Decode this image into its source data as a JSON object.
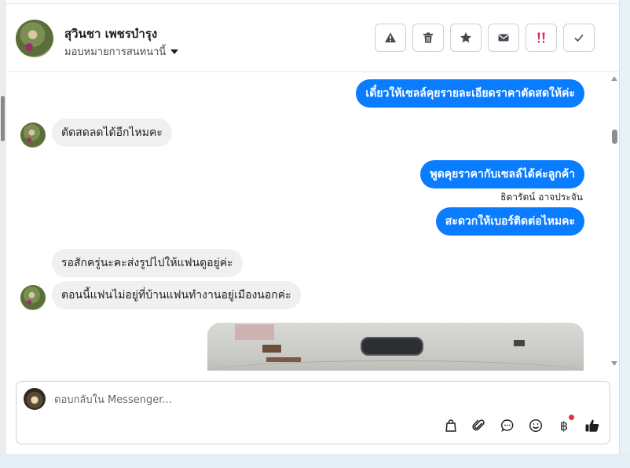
{
  "header": {
    "contact_name": "สุวินชา เพชรบำรุง",
    "assign_label": "มอบหมายการสนทนานี้",
    "actions": [
      {
        "name": "warning-icon",
        "color": "#444950"
      },
      {
        "name": "trash-icon",
        "color": "#444950"
      },
      {
        "name": "star-icon",
        "color": "#444950"
      },
      {
        "name": "mail-icon",
        "color": "#444950"
      },
      {
        "name": "double-exclamation-icon",
        "color": "#e0245e"
      },
      {
        "name": "check-icon",
        "color": "#444950"
      }
    ]
  },
  "messages": [
    {
      "type": "outgoing",
      "text": "เดี๋ยวให้เซลล์คุยรายละเอียดราคาตัดสดให้ค่ะ"
    },
    {
      "type": "incoming",
      "text": "ตัดสดลดได้อีกไหมคะ"
    },
    {
      "type": "outgoing",
      "text": "พูดคุยราคากับเซลล์ได้ค่ะลูกค้า"
    },
    {
      "type": "sender",
      "text": "ธิดารัตน์ อาจประจัน"
    },
    {
      "type": "outgoing",
      "text": "สะดวกให้เบอร์ติดต่อไหมคะ"
    },
    {
      "type": "incoming",
      "text": "รอสักครู่นะคะส่งรูปไปให้แฟนดูอยู่ค่ะ"
    },
    {
      "type": "incoming",
      "text": "ตอนนี้แฟนไม่อยู่ที่บ้านแฟนทำงานอยู่เมืองนอกค่ะ"
    }
  ],
  "composer": {
    "placeholder": "ตอบกลับใน Messenger...",
    "value": "",
    "tools": [
      "shopping-bag-icon",
      "paperclip-icon",
      "chat-bubble-icon",
      "smiley-icon",
      "baht-icon",
      "thumbs-up-icon"
    ],
    "baht_symbol": "฿"
  },
  "colors": {
    "accent": "#0a7cff",
    "incoming_bubble": "#f0f0f0",
    "notification_dot": "#f02849"
  }
}
